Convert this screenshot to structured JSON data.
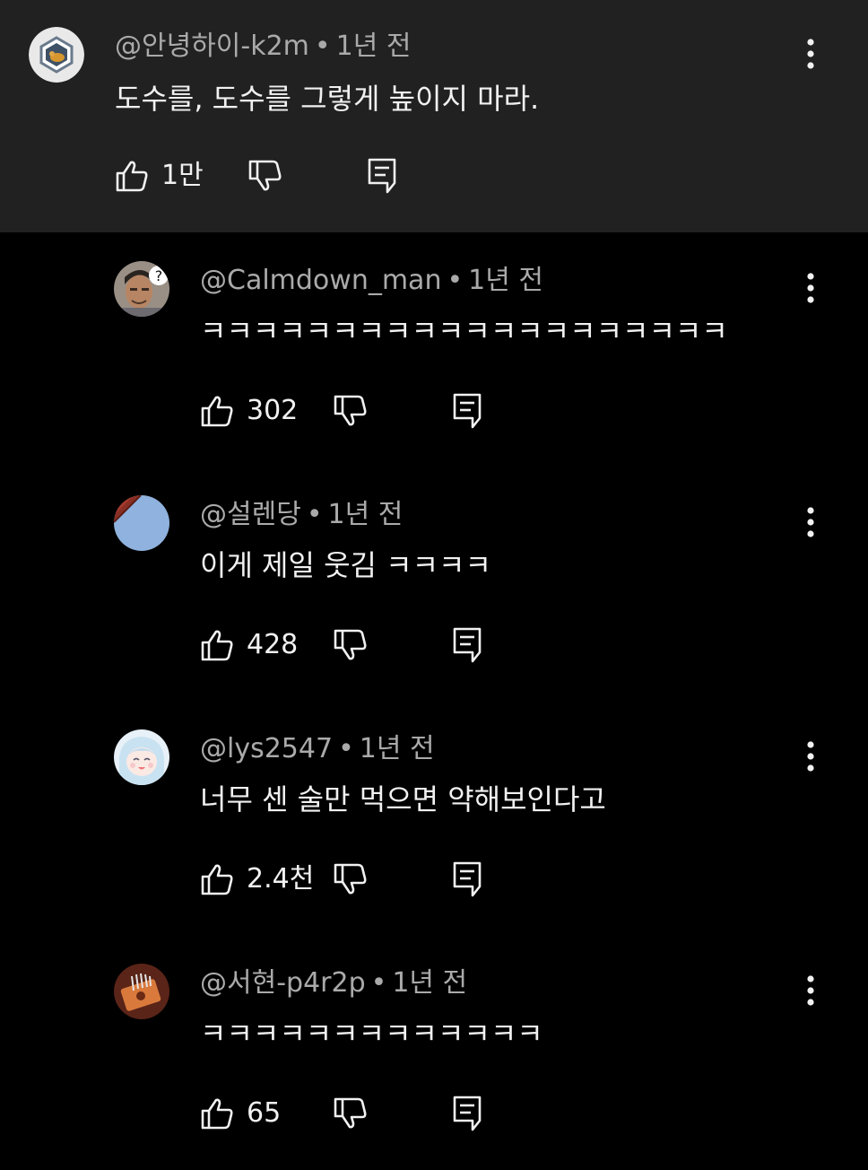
{
  "colors": {
    "page_background": "#000000",
    "top_comment_background": "#212121",
    "meta_text": "#aaaaaa",
    "body_text": "#f1f1f1"
  },
  "comments": [
    {
      "author": "@안녕하이-k2m",
      "time": "1년 전",
      "text": "도수를, 도수를 그렇게 높이지 마라.",
      "likes": "1만",
      "avatar_icon": "hexagon-pet-avatar"
    },
    {
      "author": "@Calmdown_man",
      "time": "1년 전",
      "text": "ㅋㅋㅋㅋㅋㅋㅋㅋㅋㅋㅋㅋㅋㅋㅋㅋㅋㅋㅋㅋ",
      "likes": "302",
      "avatar_icon": "man-question-mark-avatar"
    },
    {
      "author": "@설렌당",
      "time": "1년 전",
      "text": "이게 제일 웃김 ㅋㅋㅋㅋ",
      "likes": "428",
      "avatar_icon": "sky-roof-avatar"
    },
    {
      "author": "@lys2547",
      "time": "1년 전",
      "text": "너무 센 술만 먹으면 약해보인다고",
      "likes": "2.4천",
      "avatar_icon": "anime-girl-avatar"
    },
    {
      "author": "@서현-p4r2p",
      "time": "1년 전",
      "text": "ㅋㅋㅋㅋㅋㅋㅋㅋㅋㅋㅋㅋㅋ",
      "likes": "65",
      "avatar_icon": "kalimba-avatar"
    }
  ]
}
